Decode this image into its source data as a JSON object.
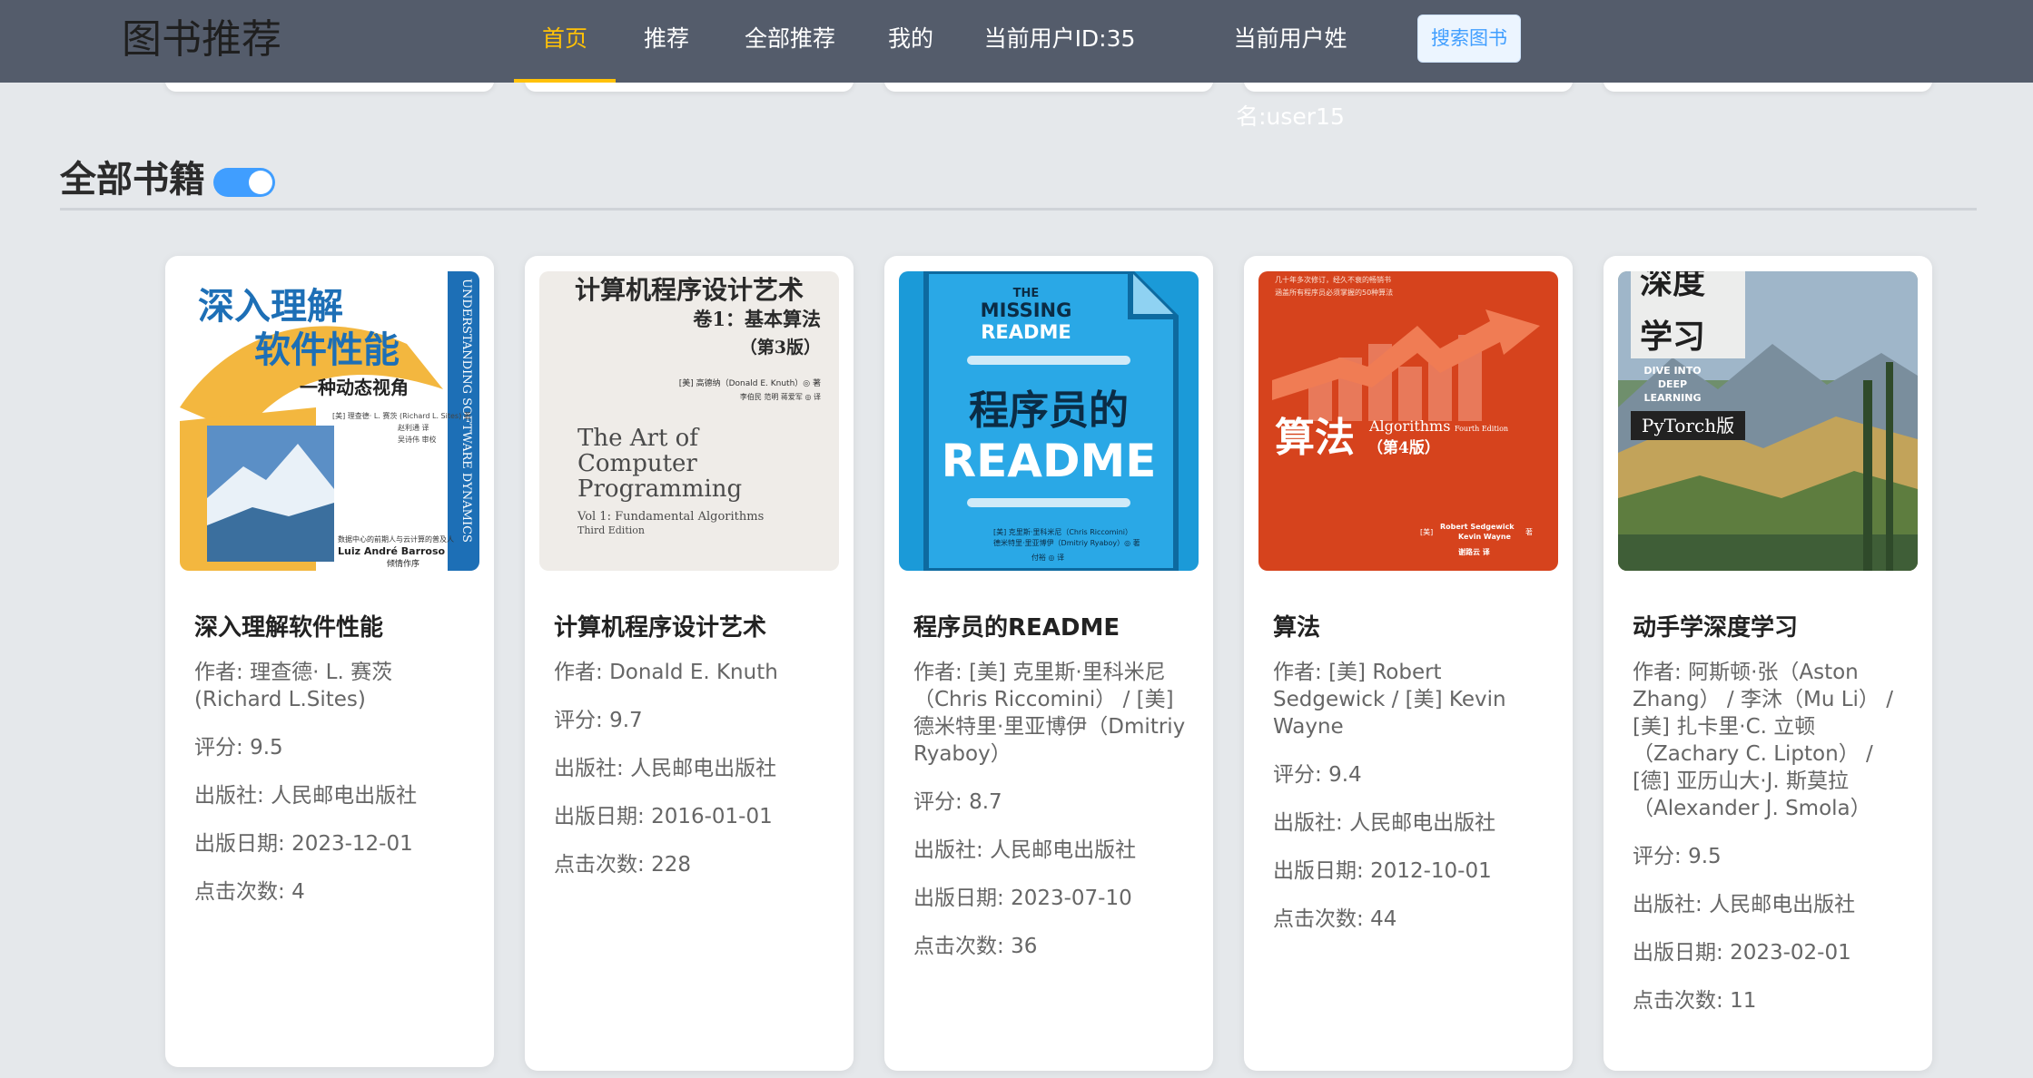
{
  "header": {
    "brand": "图书推荐",
    "nav": [
      "首页",
      "推荐",
      "全部推荐",
      "我的",
      "当前用户ID:35",
      "当前用户姓名:user15"
    ],
    "search_button": "搜索图书"
  },
  "section": {
    "title": "全部书籍",
    "toggle_on": true
  },
  "labels": {
    "author": "作者: ",
    "rating": "评分: ",
    "publisher": "出版社: ",
    "date": "出版日期: ",
    "clicks": "点击次数: "
  },
  "books": [
    {
      "title": "深入理解软件性能",
      "author": "理查德· L. 赛茨(Richard L.Sites)",
      "rating": "9.5",
      "publisher": "人民邮电出版社",
      "date": "2023-12-01",
      "clicks": "4",
      "cover": {
        "title_line1": "深入理解",
        "title_line2": "软件性能",
        "subtitle": "一种动态视角",
        "spine": "UNDERSTANDING SOFTWARE DYNAMICS",
        "credit_line1": "[美] 理查德· L. 赛茨 (Richard L. Sites) 著",
        "credit_line2": "赵利通 译",
        "credit_line3": "吴诗伟 审校",
        "foreword_line1": "数据中心的前期人与云计算的普及人",
        "foreword_line2": "Luiz André Barroso",
        "foreword_line3": "倾情作序"
      }
    },
    {
      "title": "计算机程序设计艺术",
      "author": "Donald E. Knuth",
      "rating": "9.7",
      "publisher": "人民邮电出版社",
      "date": "2016-01-01",
      "clicks": "228",
      "cover": {
        "title": "计算机程序设计艺术",
        "volume": "卷1：基本算法",
        "edition": "（第3版）",
        "author_line": "[美] 高德纳（Donald E. Knuth）◎ 著",
        "translator_line": "李伯民 范明 蒋爱军 ◎ 译",
        "en_line1": "The Art of",
        "en_line2": "Computer",
        "en_line3": "Programming",
        "en_vol": "Vol 1: Fundamental Algorithms",
        "en_edition": "Third Edition"
      }
    },
    {
      "title": "程序员的README",
      "author": "[美] 克里斯·里科米尼（Chris Riccomini） / [美] 德米特里·里亚博伊（Dmitriy Ryaboy）",
      "rating": "8.7",
      "publisher": "人民邮电出版社",
      "date": "2023-07-10",
      "clicks": "36",
      "cover": {
        "en_the": "THE",
        "en_missing": "MISSING",
        "en_readme": "README",
        "cn_title": "程序员的",
        "big_readme": "README",
        "credit_line1": "[美] 克里斯·里科米尼（Chris Riccomini）",
        "credit_line2": "德米特里·里亚博伊（Dmitriy Ryaboy）◎ 著",
        "credit_line3": "付裕 ◎ 译"
      }
    },
    {
      "title": "算法",
      "author": "[美] Robert Sedgewick / [美] Kevin Wayne",
      "rating": "9.4",
      "publisher": "人民邮电出版社",
      "date": "2012-10-01",
      "clicks": "44",
      "cover": {
        "top_line1": "几十年多次修订，经久不衰的畅销书",
        "top_line2": "涵盖所有程序员必须掌握的50种算法",
        "cn_title": "算法",
        "en_title": "Algorithms",
        "en_edition": "Fourth Edition",
        "edition": "（第4版）",
        "author_line1": "Robert Sedgewick",
        "author_line2": "Kevin Wayne",
        "author_prefix": "[美]",
        "author_suffix": "著",
        "translator": "谢路云 译"
      }
    },
    {
      "title": "动手学深度学习",
      "author": "阿斯顿·张（Aston Zhang） / 李沐（Mu Li） / [美] 扎卡里·C. 立顿（Zachary C. Lipton） / [德] 亚历山大·J. 斯莫拉（Alexander J. Smola）",
      "rating": "9.5",
      "publisher": "人民邮电出版社",
      "date": "2023-02-01",
      "clicks": "11",
      "cover": {
        "cn_title1": "深度",
        "cn_title2": "学习",
        "en_line1": "DIVE INTO",
        "en_line2": "DEEP",
        "en_line3": "LEARNING",
        "badge": "PyTorch版"
      }
    }
  ]
}
